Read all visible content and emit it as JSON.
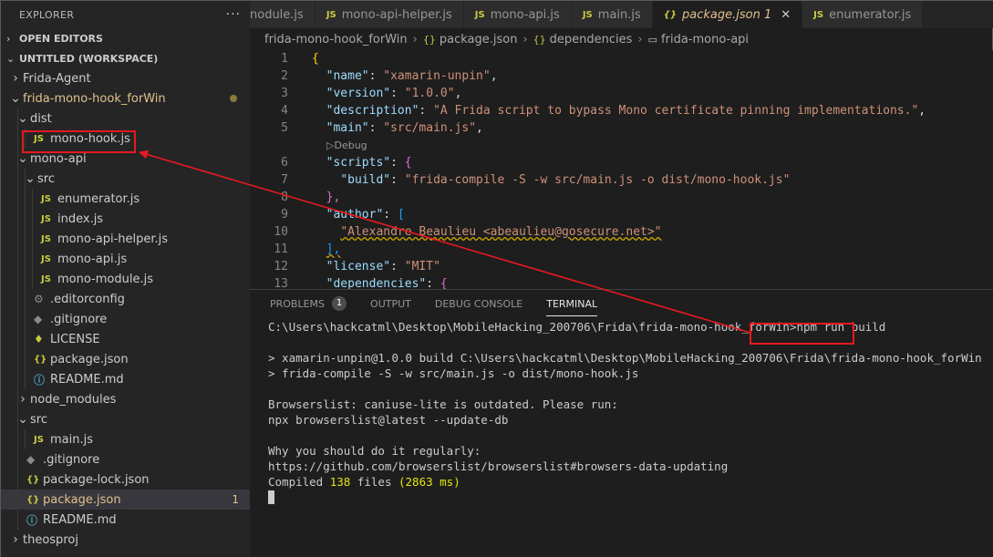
{
  "explorer": {
    "title": "EXPLORER",
    "more": "···",
    "open_editors": "OPEN EDITORS",
    "workspace": "UNTITLED (WORKSPACE)",
    "tree": [
      {
        "label": "Frida-Agent",
        "kind": "folder",
        "open": false,
        "depth": 0
      },
      {
        "label": "frida-mono-hook_forWin",
        "kind": "folder",
        "open": true,
        "depth": 0,
        "modified": true
      },
      {
        "label": "dist",
        "kind": "folder",
        "open": true,
        "depth": 1
      },
      {
        "label": "mono-hook.js",
        "kind": "js",
        "depth": 2
      },
      {
        "label": "mono-api",
        "kind": "folder",
        "open": true,
        "depth": 1
      },
      {
        "label": "src",
        "kind": "folder",
        "open": true,
        "depth": 2
      },
      {
        "label": "enumerator.js",
        "kind": "js",
        "depth": 3
      },
      {
        "label": "index.js",
        "kind": "js",
        "depth": 3
      },
      {
        "label": "mono-api-helper.js",
        "kind": "js",
        "depth": 3
      },
      {
        "label": "mono-api.js",
        "kind": "js",
        "depth": 3
      },
      {
        "label": "mono-module.js",
        "kind": "js",
        "depth": 3
      },
      {
        "label": ".editorconfig",
        "kind": "gear",
        "depth": 2
      },
      {
        "label": ".gitignore",
        "kind": "git",
        "depth": 2
      },
      {
        "label": "LICENSE",
        "kind": "lic",
        "depth": 2
      },
      {
        "label": "package.json",
        "kind": "json",
        "depth": 2
      },
      {
        "label": "README.md",
        "kind": "info",
        "depth": 2
      },
      {
        "label": "node_modules",
        "kind": "folder",
        "open": false,
        "depth": 1
      },
      {
        "label": "src",
        "kind": "folder",
        "open": true,
        "depth": 1
      },
      {
        "label": "main.js",
        "kind": "js",
        "depth": 2
      },
      {
        "label": ".gitignore",
        "kind": "git",
        "depth": 1
      },
      {
        "label": "package-lock.json",
        "kind": "json",
        "depth": 1
      },
      {
        "label": "package.json",
        "kind": "json",
        "depth": 1,
        "selected": true,
        "modified": true,
        "badge": "1"
      },
      {
        "label": "README.md",
        "kind": "info",
        "depth": 1
      },
      {
        "label": "theosproj",
        "kind": "folder",
        "open": false,
        "depth": 0
      }
    ]
  },
  "tabs": [
    {
      "label": "nodule.js",
      "icon": "",
      "active": false
    },
    {
      "label": "mono-api-helper.js",
      "icon": "JS",
      "active": false
    },
    {
      "label": "mono-api.js",
      "icon": "JS",
      "active": false
    },
    {
      "label": "main.js",
      "icon": "JS",
      "active": false
    },
    {
      "label": "package.json 1",
      "icon": "{}",
      "active": true,
      "close": "✕"
    },
    {
      "label": "enumerator.js",
      "icon": "JS",
      "active": false
    }
  ],
  "breadcrumb": [
    "frida-mono-hook_forWin",
    "package.json",
    "dependencies",
    "frida-mono-api"
  ],
  "breadcrumb_icons": [
    "",
    "{}",
    "{}",
    "▭"
  ],
  "editor": {
    "codelens": "Debug",
    "lines": [
      {
        "n": "1",
        "text": "{"
      },
      {
        "n": "2",
        "key": "\"name\"",
        "value": "\"xamarin-unpin\""
      },
      {
        "n": "3",
        "key": "\"version\"",
        "value": "\"1.0.0\""
      },
      {
        "n": "4",
        "key": "\"description\"",
        "value": "\"A Frida script to bypass Mono certificate pinning implementations.\""
      },
      {
        "n": "5",
        "key": "\"main\"",
        "value": "\"src/main.js\""
      },
      {
        "n": "6",
        "key": "\"scripts\""
      },
      {
        "n": "7",
        "key": "\"build\"",
        "value": "\"frida-compile -S -w src/main.js -o dist/mono-hook.js\""
      },
      {
        "n": "8",
        "text": "},"
      },
      {
        "n": "9",
        "key": "\"author\""
      },
      {
        "n": "10",
        "value": "\"Alexandre Beaulieu <abeaulieu@gosecure.net>\""
      },
      {
        "n": "11",
        "text": "],"
      },
      {
        "n": "12",
        "key": "\"license\"",
        "value": "\"MIT\""
      },
      {
        "n": "13",
        "key": "\"dependencies\""
      }
    ]
  },
  "panel": {
    "tabs": [
      {
        "label": "PROBLEMS",
        "count": "1",
        "active": false
      },
      {
        "label": "OUTPUT",
        "active": false
      },
      {
        "label": "DEBUG CONSOLE",
        "active": false
      },
      {
        "label": "TERMINAL",
        "active": true
      }
    ],
    "terminal": {
      "prompt": "C:\\Users\\hackcatml\\Desktop\\MobileHacking_200706\\Frida\\frida-mono-hook_forWin>",
      "command": "npm run build",
      "out1": "> xamarin-unpin@1.0.0 build C:\\Users\\hackcatml\\Desktop\\MobileHacking_200706\\Frida\\frida-mono-hook_forWin",
      "out2": "> frida-compile -S -w src/main.js -o dist/mono-hook.js",
      "out3": "Browserslist: caniuse-lite is outdated. Please run:",
      "out4": "npx browserslist@latest --update-db",
      "out5": "Why you should do it regularly:",
      "out6": "https://github.com/browserslist/browserslist#browsers-data-updating",
      "compiled_prefix": "Compiled ",
      "compiled_count": "138",
      "compiled_mid": " files ",
      "compiled_time": "(2863 ms)"
    }
  },
  "colors": {
    "annotation": "#e8191f",
    "modified": "#e2c08d"
  }
}
